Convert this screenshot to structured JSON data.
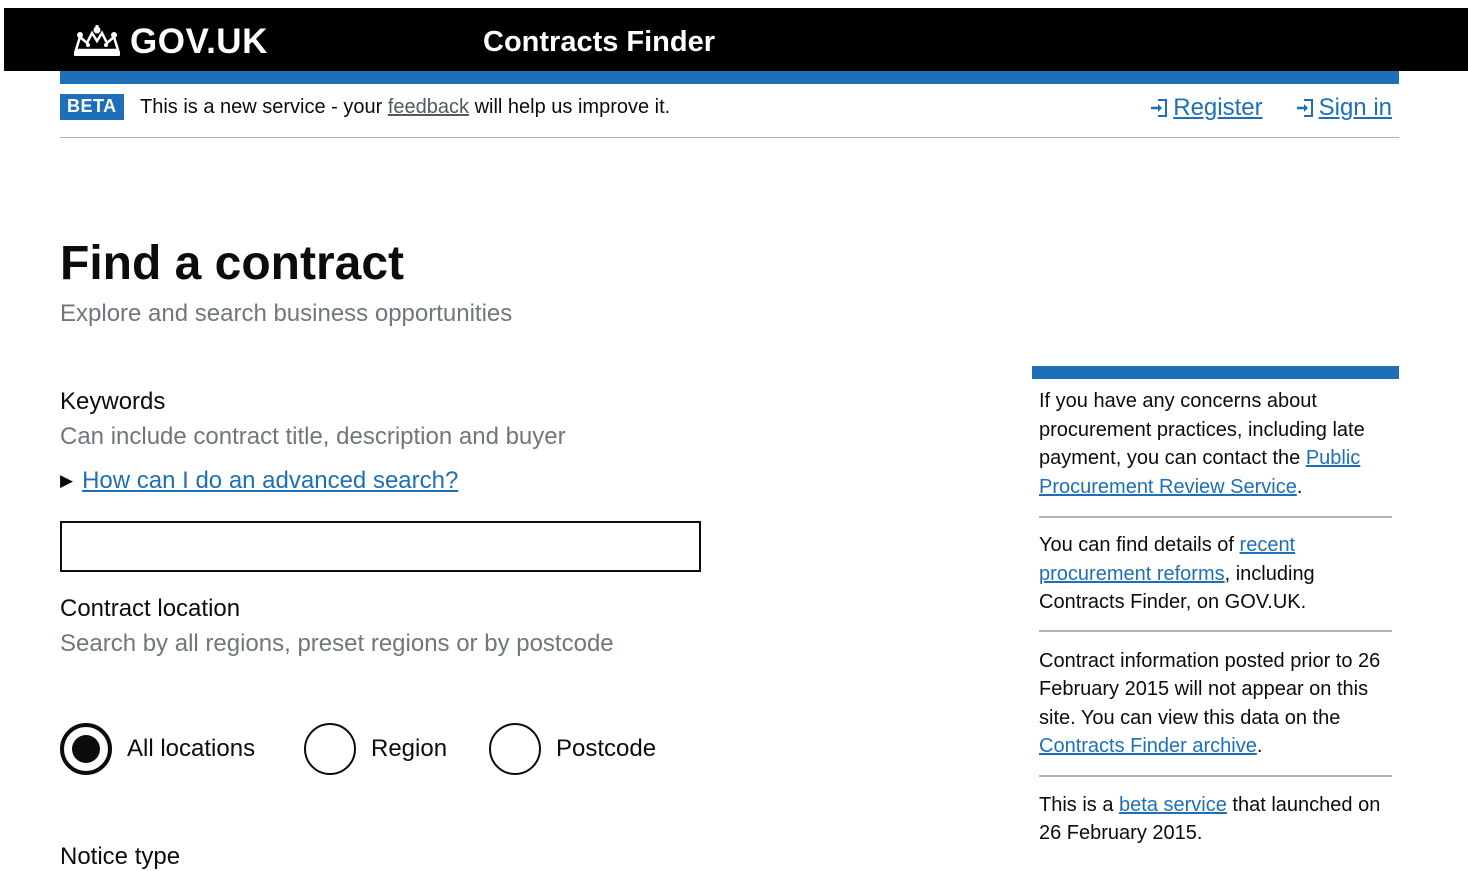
{
  "header": {
    "logo_text": "GOV.UK",
    "service_name": "Contracts Finder"
  },
  "phase_banner": {
    "tag": "BETA",
    "text_before": "This is a new service - your ",
    "feedback_link": "feedback",
    "text_after": " will help us improve it.",
    "register_label": "Register",
    "signin_label": "Sign in"
  },
  "page": {
    "title": "Find a contract",
    "subtitle": "Explore and search business opportunities"
  },
  "keywords": {
    "label": "Keywords",
    "hint": "Can include contract title, description and buyer",
    "advanced_search_link": "How can I do an advanced search?",
    "value": "",
    "placeholder": ""
  },
  "location": {
    "label": "Contract location",
    "hint": "Search by all regions, preset regions or by postcode",
    "options": [
      {
        "label": "All locations",
        "checked": true
      },
      {
        "label": "Region",
        "checked": false
      },
      {
        "label": "Postcode",
        "checked": false
      }
    ]
  },
  "notice_type": {
    "label": "Notice type"
  },
  "sidebar": {
    "concerns": {
      "text_before": "If you have any concerns about procurement practices, including late payment, you can contact the ",
      "link": "Public Procurement Review Service",
      "text_after": "."
    },
    "reforms": {
      "text_before": "You can find details of ",
      "link": "recent procurement reforms",
      "text_after": ", including Contracts Finder, on GOV.UK."
    },
    "archive": {
      "text_before": "Contract information posted prior to 26 February 2015 will not appear on this site. You can view this data on the ",
      "link": "Contracts Finder archive",
      "text_after": "."
    },
    "beta": {
      "text_before": "This is a ",
      "link": "beta service",
      "text_after": " that launched on 26 February 2015."
    }
  },
  "colors": {
    "header_bg": "#000000",
    "accent_blue": "#1d70b8",
    "link": "#1d70b8",
    "hint_text": "#6f777b",
    "divider": "#b1b4b6"
  },
  "icons": {
    "logo": "crown-icon",
    "auth": "sign-in-icon",
    "details": "triangle-right-icon"
  }
}
